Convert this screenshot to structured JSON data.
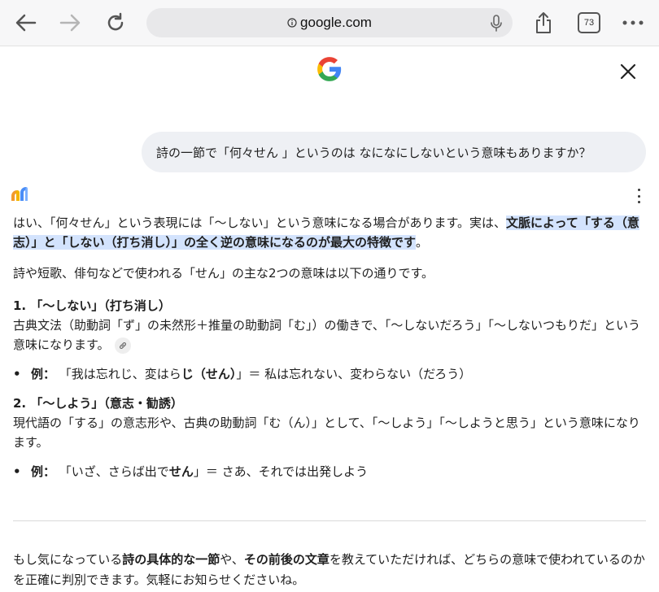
{
  "browser": {
    "url": "google.com",
    "tab_count": "73"
  },
  "colors": {
    "highlight": "#d3e3fd",
    "query_bg": "#eef0f4"
  },
  "query": {
    "text": "詩の一節で「何々せん 」というのは なになにしないという意味もありますか？"
  },
  "answer": {
    "intro_plain": "はい、「何々せん」という表現には「〜しない」という意味になる場合があります。実は、",
    "intro_highlight": "文脈によって「する（意志）」と「しない（打ち消し）」の全く逆の意味になるのが最大の特徴です",
    "intro_end": "。",
    "subtitle": "詩や短歌、俳句などで使われる「せん」の主な2つの意味は以下の通りです。",
    "section1": {
      "heading": "1. 「〜しない」（打ち消し）",
      "body": "古典文法（助動詞「ず」の未然形＋推量の助動詞「む」）の働きで、「〜しないだろう」「〜しないつもりだ」という意味になります。",
      "example_label": "例：",
      "example_a": "「我は忘れじ、変はら",
      "example_bold": "じ（せん）",
      "example_b": "」＝ 私は忘れない、変わらない（だろう）"
    },
    "section2": {
      "heading": "2. 「〜しよう」（意志・勧誘）",
      "body": "現代語の「する」の意志形や、古典の助動詞「む（ん）」として、「〜しよう」「〜しようと思う」という意味になります。",
      "example_label": "例：",
      "example_a": "「いざ、さらば出で",
      "example_bold": "せん",
      "example_b": "」＝ さあ、それでは出発しよう"
    },
    "closing": {
      "t1": "もし気になっている",
      "b1": "詩の具体的な一節",
      "t2": "や、",
      "b2": "その前後の文章",
      "t3": "を教えていただければ、どちらの意味で使われているのかを正確に判別できます。気軽にお知らせくださいね。"
    }
  }
}
